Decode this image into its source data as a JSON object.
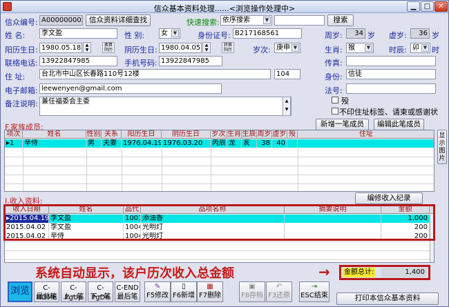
{
  "window": {
    "title": "信众基本资料处理......<浏览操作处理中>"
  },
  "top": {
    "id_label": "信众编号:",
    "id_value": "A000000005",
    "detail_btn": "信众资料详细查找",
    "quick_label": "快速搜索:",
    "quick_select": "依序搜索",
    "quick_input": "",
    "search_btn": "搜索"
  },
  "person": {
    "name_label": "姓 名:",
    "name": "李文盈",
    "gender_label": "性 别:",
    "gender": "女",
    "idcard_label": "身份证号:",
    "idcard": "B217168561",
    "age_label": "周岁:",
    "age": "34",
    "age_unit": "岁",
    "xu_label": "虚岁:",
    "xu": "36",
    "xu_unit": "岁",
    "solar_label": "阳历生日:",
    "solar": "1980.05.18",
    "solar_btn": "换算阴历",
    "lunar_label": "阴历生日:",
    "lunar": "1980.04.05",
    "lunar_btn": "转换阳历",
    "suici_label": "岁次:",
    "suici": "庚申",
    "zodiac_label": "生肖:",
    "zodiac": "猴",
    "shichen_label": "时辰:",
    "shichen": "卯",
    "shi_unit": "时",
    "phone_label": "联络电话:",
    "phone": "13922847985",
    "mobile_label": "手机号码:",
    "mobile": "13922847985",
    "fax_label": "传真:",
    "fax": "",
    "addr_label": "住 址:",
    "addr": "台北市中山区长春路110号12楼",
    "addr_no": "104",
    "identity_label": "身份:",
    "identity": "信徒",
    "email_label": "电子邮箱:",
    "email": "leewenyen@gmail.com",
    "fahao_label": "法号:",
    "fahao": "",
    "remark_label": "备注说明:",
    "remark": "兼任福委会主委",
    "deceased_label": "殁",
    "noprint_label": "不印住址标签、请柬或感谢状"
  },
  "family": {
    "section_label": "F.家族成员:",
    "add_btn": "新增一笔成员",
    "edit_btn": "编辑此笔成员",
    "side_btn": "显示图片",
    "headers": [
      "项次",
      "姓名",
      "性别",
      "关系",
      "阳历生日",
      "阴历生日",
      "岁次",
      "生肖",
      "生辰",
      "周岁",
      "虚岁",
      "殁",
      "住址"
    ],
    "rows": [
      [
        "1",
        "辛侍",
        "男",
        "夫妻",
        "1976.04.19",
        "1976.03.20",
        "丙辰",
        "龙",
        "亥",
        "38",
        "40",
        "",
        ""
      ]
    ]
  },
  "income": {
    "section_label": "I.收入资料:",
    "edit_btn": "编修收入纪录",
    "headers": [
      "收入日期",
      "姓名",
      "品代",
      "品项名称",
      "摘要说明",
      "金额"
    ],
    "rows": [
      [
        "2015.04.19",
        "李文盈",
        "1001",
        "添油香",
        "",
        "1,000"
      ],
      [
        "2015.04.02",
        "李文盈",
        "1004",
        "光明灯",
        "",
        "200"
      ],
      [
        "2015.04.02",
        "辛侍",
        "1004",
        "光明灯",
        "",
        "200"
      ]
    ],
    "annotation": "系统自动显示，该户历次收入总金额",
    "total_label": "金额总计:",
    "total_value": "1,400"
  },
  "toolbar": {
    "browse": "浏览",
    "home_a": "C-HOME",
    "home_b": "最前笔",
    "pgup_a": "C-PgUp",
    "pgup_b": "上一笔",
    "pgdn_a": "C-PgDn",
    "pgdn_b": "下一笔",
    "end_a": "C-END",
    "end_b": "最后笔",
    "f5": "F5修改",
    "f6": "F6新增",
    "f7": "F7删除",
    "f8": "F8存档",
    "f3": "F3还原",
    "esc": "ESC结束",
    "print": "打印本信众基本资料"
  },
  "colors": {
    "accent": "#1a2aa0",
    "section": "#c01818",
    "highlight": "#00e5e5",
    "annotation": "#c81818"
  }
}
